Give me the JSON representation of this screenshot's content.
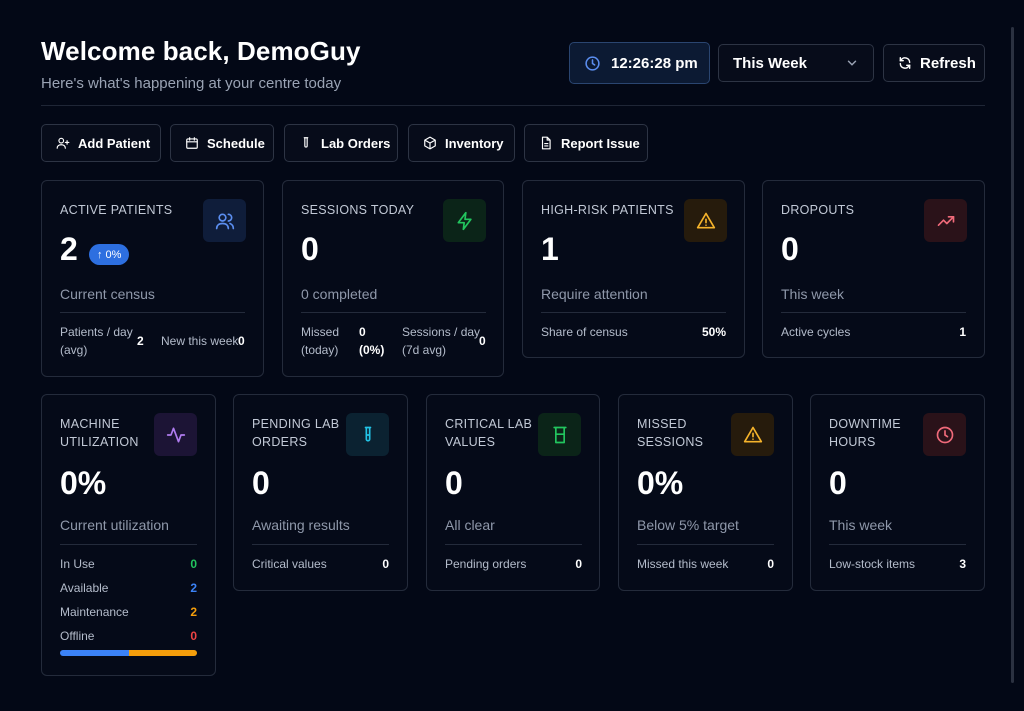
{
  "header": {
    "title": "Welcome back, DemoGuy",
    "subtitle": "Here's what's happening at your centre today",
    "clock": "12:26:28 pm",
    "period": "This Week",
    "refresh_label": "Refresh"
  },
  "quick_actions": [
    "Add Patient",
    "Schedule",
    "Lab Orders",
    "Inventory",
    "Report Issue"
  ],
  "stats": {
    "active_patients": {
      "title": "ACTIVE PATIENTS",
      "value": "2",
      "badge": "0%",
      "desc": "Current census",
      "l1": "Patients / day",
      "l1b": "(avg)",
      "v1": "2",
      "l2": "New this week",
      "v2": "0"
    },
    "sessions_today": {
      "title": "SESSIONS TODAY",
      "value": "0",
      "desc": "0 completed",
      "l1": "Missed",
      "l1b": "(today)",
      "v1": "0",
      "v1b": "(0%)",
      "l2": "Sessions / day",
      "l2b": "(7d avg)",
      "v2": "0"
    },
    "high_risk": {
      "title": "HIGH-RISK PATIENTS",
      "value": "1",
      "desc": "Require attention",
      "l1": "Share of census",
      "v1": "50%"
    },
    "dropouts": {
      "title": "DROPOUTS",
      "value": "0",
      "desc": "This week",
      "l1": "Active cycles",
      "v1": "1"
    },
    "machine": {
      "title1": "MACHINE",
      "title2": "UTILIZATION",
      "value": "0%",
      "desc": "Current utilization",
      "rows": [
        {
          "label": "In Use",
          "value": "0",
          "color": "#22c55e"
        },
        {
          "label": "Available",
          "value": "2",
          "color": "#3b82f6"
        },
        {
          "label": "Maintenance",
          "value": "2",
          "color": "#f59e0b"
        },
        {
          "label": "Offline",
          "value": "0",
          "color": "#ef4444"
        }
      ],
      "bar": {
        "available": 0.5,
        "maintenance": 0.5
      }
    },
    "pending_lab": {
      "title1": "PENDING LAB",
      "title2": "ORDERS",
      "value": "0",
      "desc": "Awaiting results",
      "l1": "Critical values",
      "v1": "0"
    },
    "critical_lab": {
      "title1": "CRITICAL LAB",
      "title2": "VALUES",
      "value": "0",
      "desc": "All clear",
      "l1": "Pending orders",
      "v1": "0"
    },
    "missed": {
      "title1": "MISSED",
      "title2": "SESSIONS",
      "value": "0%",
      "desc": "Below 5% target",
      "l1": "Missed this week",
      "v1": "0"
    },
    "downtime": {
      "title1": "DOWNTIME",
      "title2": "HOURS",
      "value": "0",
      "desc": "This week",
      "l1": "Low-stock items",
      "v1": "3"
    }
  },
  "icons": {
    "clock": "clock-icon",
    "chevron": "chevron-down-icon",
    "refresh": "refresh-icon",
    "active_patients": "users-icon",
    "sessions_today": "zap-icon",
    "high_risk": "alert-triangle-icon",
    "dropouts": "trending-up-icon",
    "machine": "activity-icon",
    "pending_lab": "test-tube-icon",
    "critical_lab": "beaker-icon",
    "missed": "alert-triangle-icon",
    "downtime": "clock-icon"
  }
}
